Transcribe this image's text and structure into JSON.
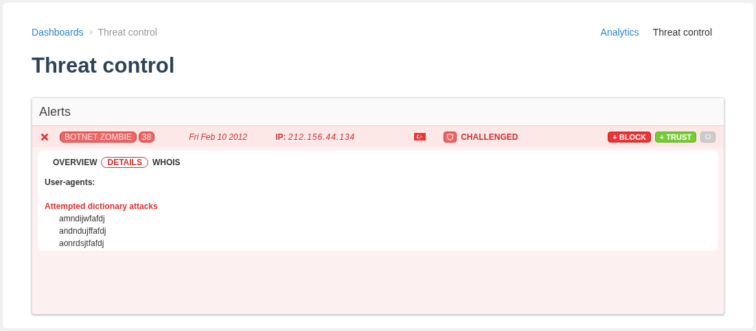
{
  "breadcrumb": [
    {
      "label": "Dashboards",
      "link": true
    },
    {
      "label": "Threat control",
      "link": false
    }
  ],
  "nav": [
    {
      "label": "Analytics",
      "selected": false
    },
    {
      "label": "Threat control",
      "selected": true
    }
  ],
  "title": "Threat control",
  "panel": {
    "title": "Alerts",
    "alert": {
      "type": "BOTNET ZOMBIE",
      "count": "38",
      "date": "Fri Feb 10 2012",
      "ip_label": "IP:",
      "ip": "212.156.44.134",
      "status": "CHALLENGED",
      "actions": [
        {
          "label": "+ BLOCK",
          "kind": "block"
        },
        {
          "label": "+ TRUST",
          "kind": "trust"
        },
        {
          "kind": "more"
        }
      ],
      "tabs": [
        {
          "label": "OVERVIEW",
          "selected": false
        },
        {
          "label": "DETAILS",
          "selected": true
        },
        {
          "label": "WHOIS",
          "selected": false
        }
      ],
      "user_agents_label": "User-agents:",
      "attacks_label": "Attempted dictionary attacks",
      "attacks": [
        "amndijwfafdj",
        "andndujffafdj",
        "aonrdsjtfafdj"
      ]
    }
  }
}
